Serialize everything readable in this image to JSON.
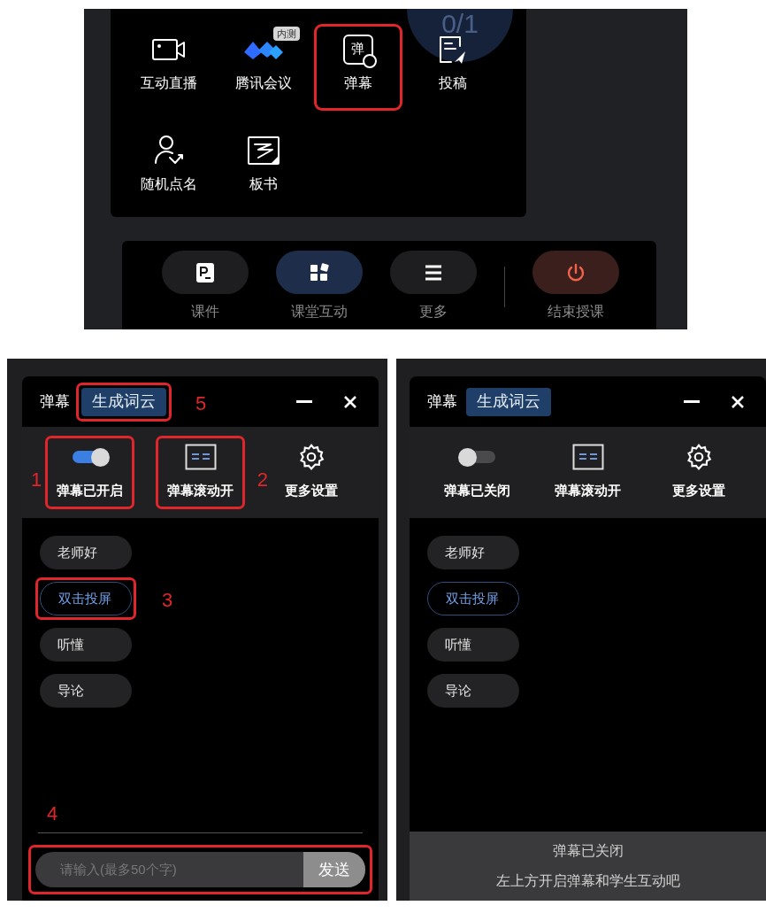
{
  "menu_panel": {
    "counter": "0/1",
    "tools": [
      {
        "label": "互动直播",
        "callout": false
      },
      {
        "label": "腾讯会议",
        "badge": "内测",
        "callout": false
      },
      {
        "icon_text": "弹",
        "label": "弹幕",
        "callout": true
      },
      {
        "label": "投稿",
        "callout": false
      },
      {
        "label": "随机点名",
        "callout": false
      },
      {
        "label": "板书",
        "callout": false
      }
    ],
    "bottom_bar": [
      {
        "label": "课件",
        "kind": "normal",
        "selected": false
      },
      {
        "label": "课堂互动",
        "kind": "normal",
        "selected": true
      },
      {
        "label": "更多",
        "kind": "normal",
        "selected": false
      },
      {
        "label": "结束授课",
        "kind": "danger",
        "selected": false
      }
    ]
  },
  "panels": [
    {
      "title": "弹幕",
      "tab": {
        "label": "生成词云",
        "callout": "5"
      },
      "controls": [
        {
          "kind": "toggle",
          "on": true,
          "label": "弹幕已开启",
          "callout": "1"
        },
        {
          "kind": "scroll",
          "label": "弹幕滚动开",
          "callout": "2"
        },
        {
          "kind": "settings",
          "label": "更多设置"
        }
      ],
      "phrases": [
        {
          "label": "老师好",
          "selected": false
        },
        {
          "label": "双击投屏",
          "selected": true,
          "callout": "3"
        },
        {
          "label": "听懂",
          "selected": false
        },
        {
          "label": "导论",
          "selected": false
        }
      ],
      "footer": {
        "kind": "input",
        "placeholder": "请输入(最多50个字)",
        "send": "发送",
        "callout": "4"
      }
    },
    {
      "title": "弹幕",
      "tab": {
        "label": "生成词云"
      },
      "controls": [
        {
          "kind": "toggle",
          "on": false,
          "label": "弹幕已关闭"
        },
        {
          "kind": "scroll",
          "label": "弹幕滚动开"
        },
        {
          "kind": "settings",
          "label": "更多设置"
        }
      ],
      "phrases": [
        {
          "label": "老师好",
          "selected": false
        },
        {
          "label": "双击投屏",
          "selected": true
        },
        {
          "label": "听懂",
          "selected": false
        },
        {
          "label": "导论",
          "selected": false
        }
      ],
      "footer": {
        "kind": "notice",
        "lines": [
          "弹幕已关闭",
          "左上方开启弹幕和学生互动吧"
        ]
      }
    }
  ]
}
